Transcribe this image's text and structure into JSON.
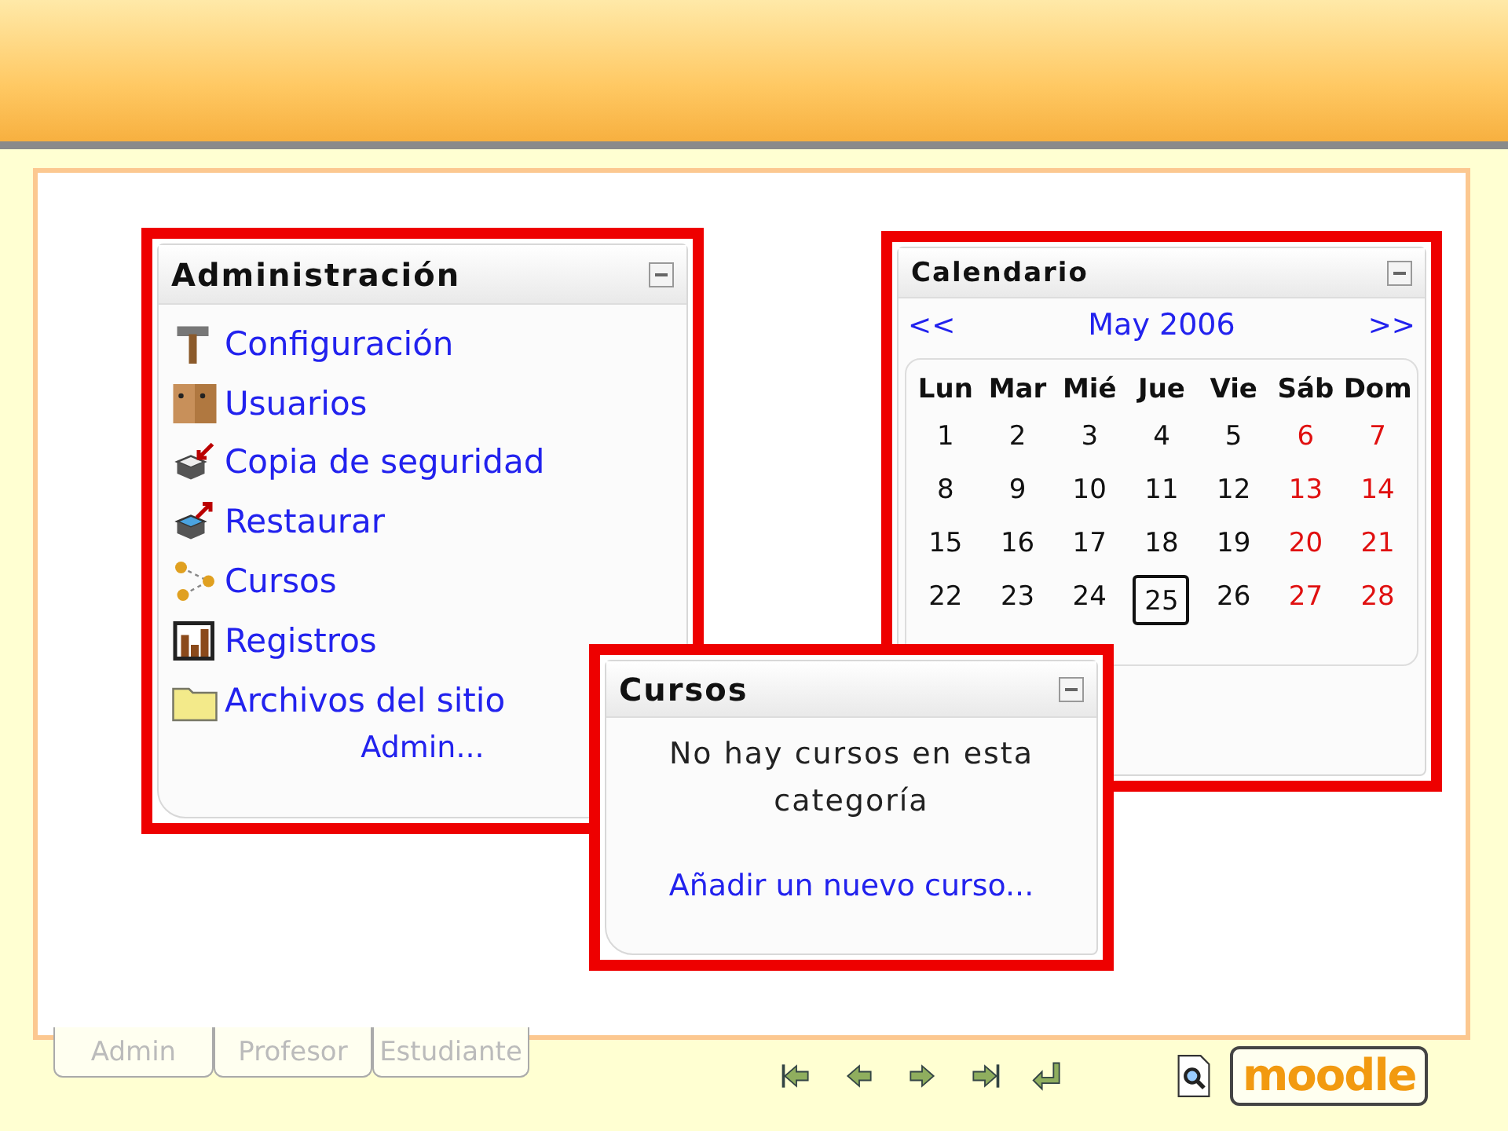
{
  "admin_block": {
    "title": "Administración",
    "items": [
      {
        "label": "Configuración",
        "kind": "hammer"
      },
      {
        "label": "Usuarios",
        "kind": "users"
      },
      {
        "label": "Copia de seguridad",
        "kind": "backup"
      },
      {
        "label": "Restaurar",
        "kind": "restore"
      },
      {
        "label": "Cursos",
        "kind": "courses"
      },
      {
        "label": "Registros",
        "kind": "logs"
      },
      {
        "label": "Archivos del sitio",
        "kind": "folder"
      }
    ],
    "more_link": "Admin..."
  },
  "calendar_block": {
    "title": "Calendario",
    "prev": "<<",
    "month": "May 2006",
    "next": ">>",
    "weekdays": [
      "Lun",
      "Mar",
      "Mié",
      "Jue",
      "Vie",
      "Sáb",
      "Dom"
    ],
    "weeks": [
      [
        {
          "day": "1",
          "weekend": false,
          "today": false
        },
        {
          "day": "2",
          "weekend": false,
          "today": false
        },
        {
          "day": "3",
          "weekend": false,
          "today": false
        },
        {
          "day": "4",
          "weekend": false,
          "today": false
        },
        {
          "day": "5",
          "weekend": false,
          "today": false
        },
        {
          "day": "6",
          "weekend": true,
          "today": false
        },
        {
          "day": "7",
          "weekend": true,
          "today": false
        }
      ],
      [
        {
          "day": "8",
          "weekend": false,
          "today": false
        },
        {
          "day": "9",
          "weekend": false,
          "today": false
        },
        {
          "day": "10",
          "weekend": false,
          "today": false
        },
        {
          "day": "11",
          "weekend": false,
          "today": false
        },
        {
          "day": "12",
          "weekend": false,
          "today": false
        },
        {
          "day": "13",
          "weekend": true,
          "today": false
        },
        {
          "day": "14",
          "weekend": true,
          "today": false
        }
      ],
      [
        {
          "day": "15",
          "weekend": false,
          "today": false
        },
        {
          "day": "16",
          "weekend": false,
          "today": false
        },
        {
          "day": "17",
          "weekend": false,
          "today": false
        },
        {
          "day": "18",
          "weekend": false,
          "today": false
        },
        {
          "day": "19",
          "weekend": false,
          "today": false
        },
        {
          "day": "20",
          "weekend": true,
          "today": false
        },
        {
          "day": "21",
          "weekend": true,
          "today": false
        }
      ],
      [
        {
          "day": "22",
          "weekend": false,
          "today": false
        },
        {
          "day": "23",
          "weekend": false,
          "today": false
        },
        {
          "day": "24",
          "weekend": false,
          "today": false
        },
        {
          "day": "25",
          "weekend": false,
          "today": true
        },
        {
          "day": "26",
          "weekend": false,
          "today": false
        },
        {
          "day": "27",
          "weekend": true,
          "today": false
        },
        {
          "day": "28",
          "weekend": true,
          "today": false
        }
      ]
    ]
  },
  "courses_block": {
    "title": "Cursos",
    "message": "No hay cursos en esta categoría",
    "link": "Añadir un nuevo curso..."
  },
  "role_tabs": [
    {
      "label": "Admin"
    },
    {
      "label": "Profesor"
    },
    {
      "label": "Estudiante"
    }
  ],
  "navigation": [
    {
      "kind": "first"
    },
    {
      "kind": "prev"
    },
    {
      "kind": "next"
    },
    {
      "kind": "last"
    },
    {
      "kind": "return"
    }
  ],
  "logo": "moodle"
}
